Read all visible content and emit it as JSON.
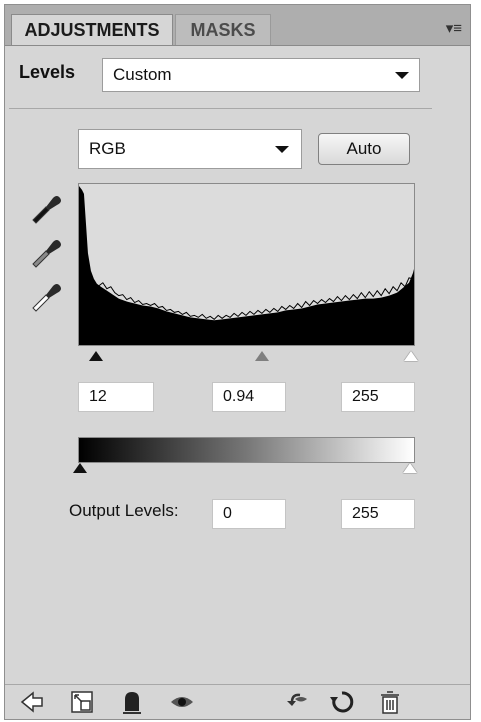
{
  "tabs": [
    {
      "label": "ADJUSTMENTS"
    },
    {
      "label": "MASKS"
    }
  ],
  "panel_menu": {
    "glyph": "▾≡"
  },
  "preset": {
    "label": "Levels",
    "value": "Custom"
  },
  "channel": {
    "value": "RGB"
  },
  "auto_label": "Auto",
  "input_levels": {
    "black": "12",
    "gamma": "0.94",
    "white": "255"
  },
  "output": {
    "label": "Output Levels:",
    "black": "0",
    "white": "255"
  },
  "icons": {
    "eyedroppers": [
      "black-point-eyedropper-icon",
      "gray-point-eyedropper-icon",
      "white-point-eyedropper-icon"
    ],
    "bottom_bar": [
      "back-arrow-icon",
      "expand-view-icon",
      "clip-to-layer-icon",
      "visibility-eye-icon",
      "view-previous-state-icon",
      "reset-icon",
      "delete-trash-icon"
    ]
  }
}
